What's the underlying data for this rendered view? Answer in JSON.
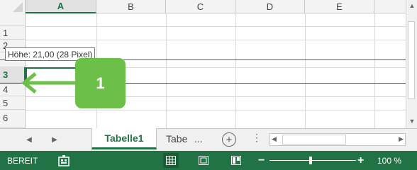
{
  "columns": [
    "A",
    "B",
    "C",
    "D",
    "E"
  ],
  "selected_column": "A",
  "rows": [
    "1",
    "2",
    "3",
    "4",
    "5",
    "6"
  ],
  "selected_row": "3",
  "tooltip": "Höhe: 21,00 (28 Pixel)",
  "callout": {
    "label": "1",
    "color": "#6cc04a"
  },
  "sheet_tabs": {
    "active": "Tabelle1",
    "partial": "Tabe",
    "overflow": "...",
    "add_label": "+"
  },
  "status": {
    "text": "BEREIT",
    "zoom": "100 %"
  },
  "colors": {
    "accent": "#217346",
    "status_bar": "#217346"
  },
  "icons": [
    "select-all-icon",
    "scroll-up-icon",
    "scroll-down-icon",
    "prev-sheet-icon",
    "next-sheet-icon",
    "add-sheet-icon",
    "macro-record-icon",
    "normal-view-icon",
    "page-layout-view-icon",
    "page-break-view-icon"
  ]
}
